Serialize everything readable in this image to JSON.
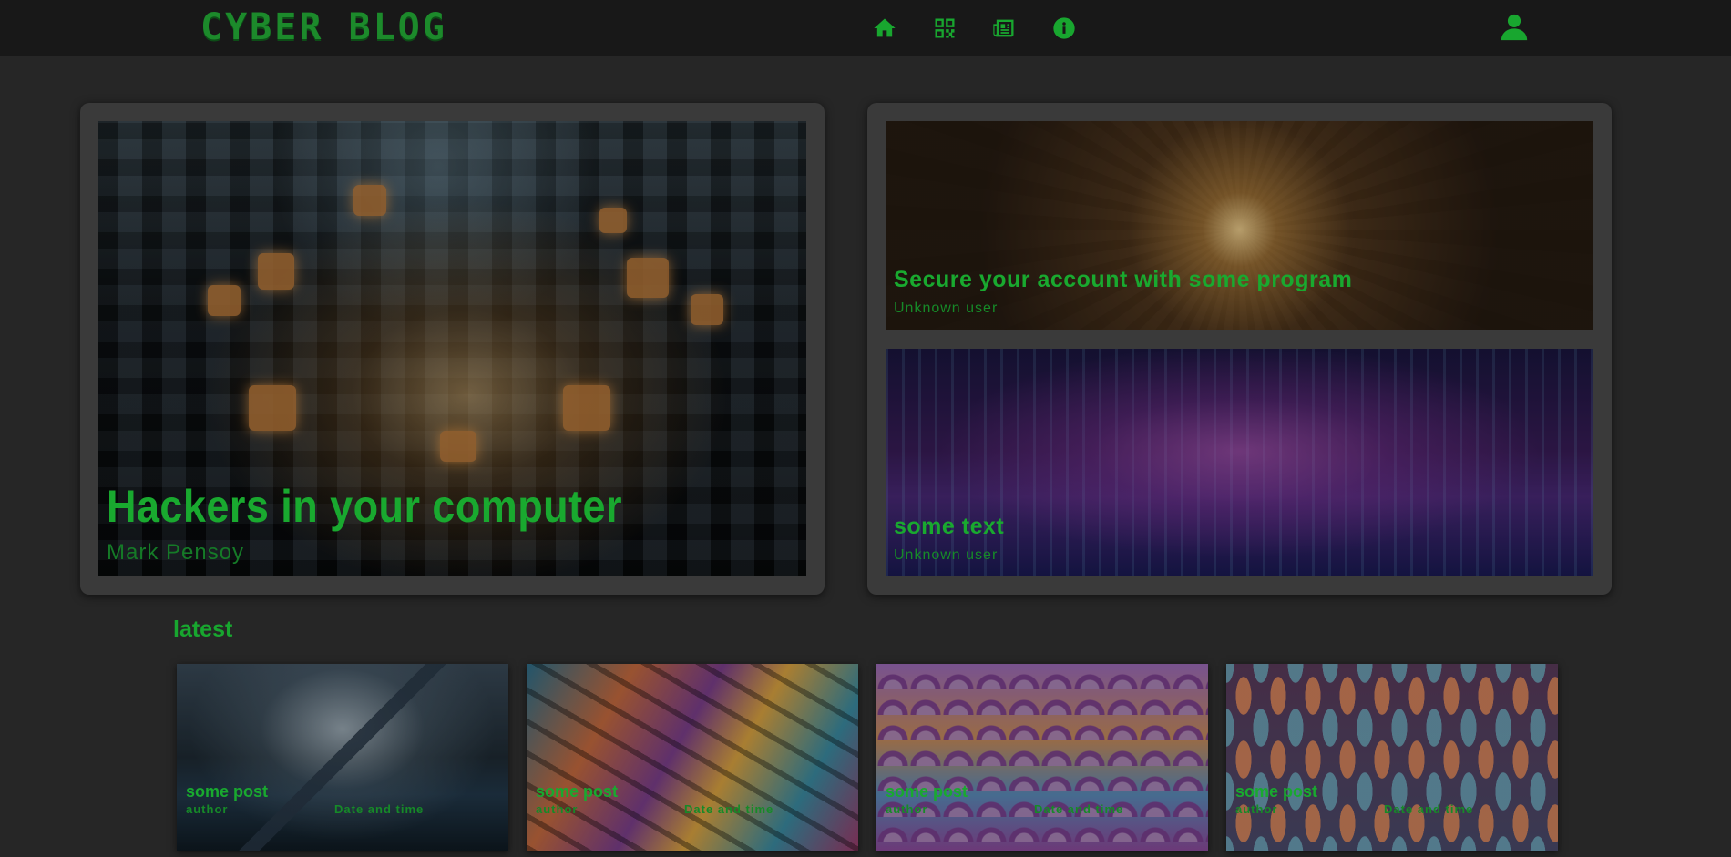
{
  "header": {
    "logo": "CYBER BLOG",
    "nav": [
      {
        "icon": "home-icon"
      },
      {
        "icon": "qr-code-icon"
      },
      {
        "icon": "newspaper-icon"
      },
      {
        "icon": "info-icon"
      }
    ],
    "user_icon": "user-icon"
  },
  "featured": {
    "main": {
      "title": "Hackers in your computer",
      "author": "Mark Pensoy"
    },
    "side": [
      {
        "title": "Secure your account with some program",
        "author": "Unknown user"
      },
      {
        "title": "some text",
        "author": "Unknown user"
      }
    ]
  },
  "latest": {
    "heading": "latest",
    "posts": [
      {
        "title": "some post",
        "author": "author",
        "date": "Date and time"
      },
      {
        "title": "some post",
        "author": "author",
        "date": "Date and time"
      },
      {
        "title": "some post",
        "author": "author",
        "date": "Date and time"
      },
      {
        "title": "some post",
        "author": "author",
        "date": "Date and time"
      }
    ]
  },
  "colors": {
    "accent": "#18a62f",
    "background": "#262626",
    "header": "#181818",
    "panel": "#3a3a3a"
  }
}
